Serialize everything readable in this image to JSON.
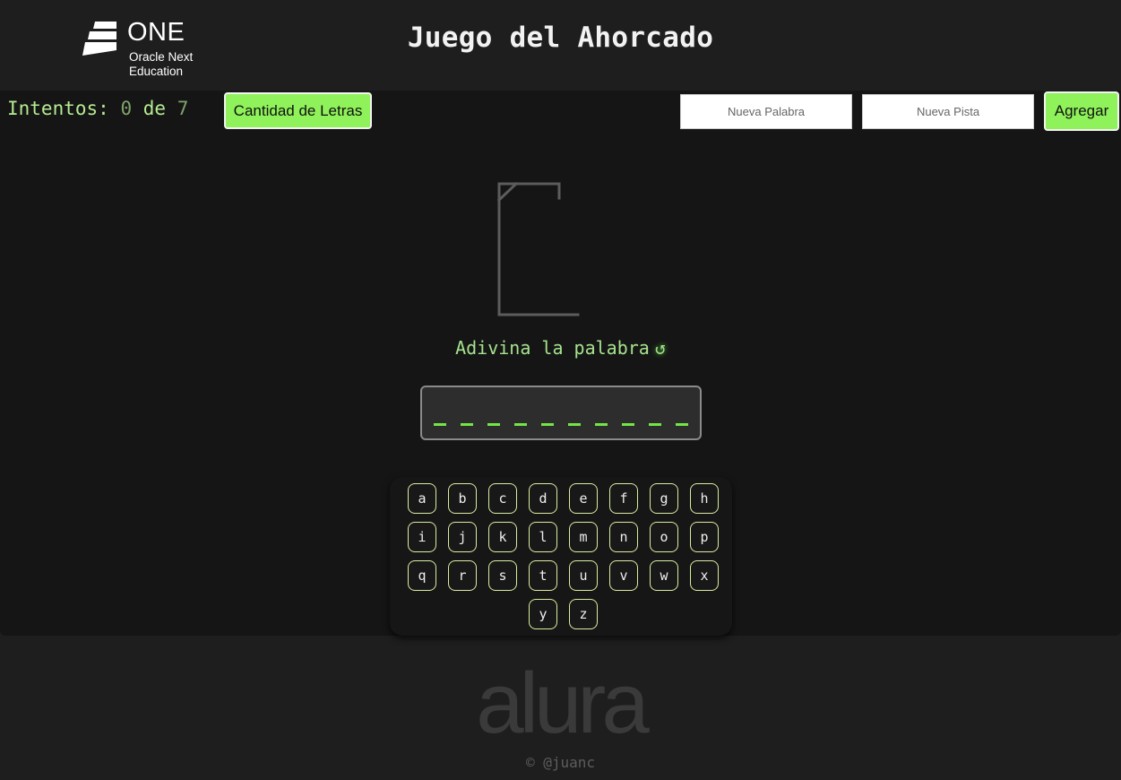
{
  "header": {
    "logo_word": "ONE",
    "logo_sub": "Oracle Next Education",
    "title": "Juego del Ahorcado"
  },
  "toolbar": {
    "attempts_label": "Intentos:",
    "attempts_current": "0",
    "attempts_of": "de",
    "attempts_max": "7",
    "letters_button": "Cantidad de Letras",
    "new_word_placeholder": "Nueva Palabra",
    "new_hint_placeholder": "Nueva Pista",
    "add_button": "Agregar"
  },
  "game": {
    "prompt": "Adivina la palabra",
    "reset_icon": "↺",
    "slot_count": 10
  },
  "keyboard": {
    "keys": [
      "a",
      "b",
      "c",
      "d",
      "e",
      "f",
      "g",
      "h",
      "i",
      "j",
      "k",
      "l",
      "m",
      "n",
      "o",
      "p",
      "q",
      "r",
      "s",
      "t",
      "u",
      "v",
      "w",
      "x",
      "y",
      "z"
    ]
  },
  "footer": {
    "brand": "alura",
    "credit": "© @juanc"
  },
  "colors": {
    "accent_green": "#8ff25a",
    "slot_green": "#73e646",
    "key_border": "#d8eea0",
    "background": "#1e1e1e",
    "panel": "#151515"
  },
  "icons": [
    "one-logo-icon",
    "gallows-icon",
    "reset-icon"
  ]
}
